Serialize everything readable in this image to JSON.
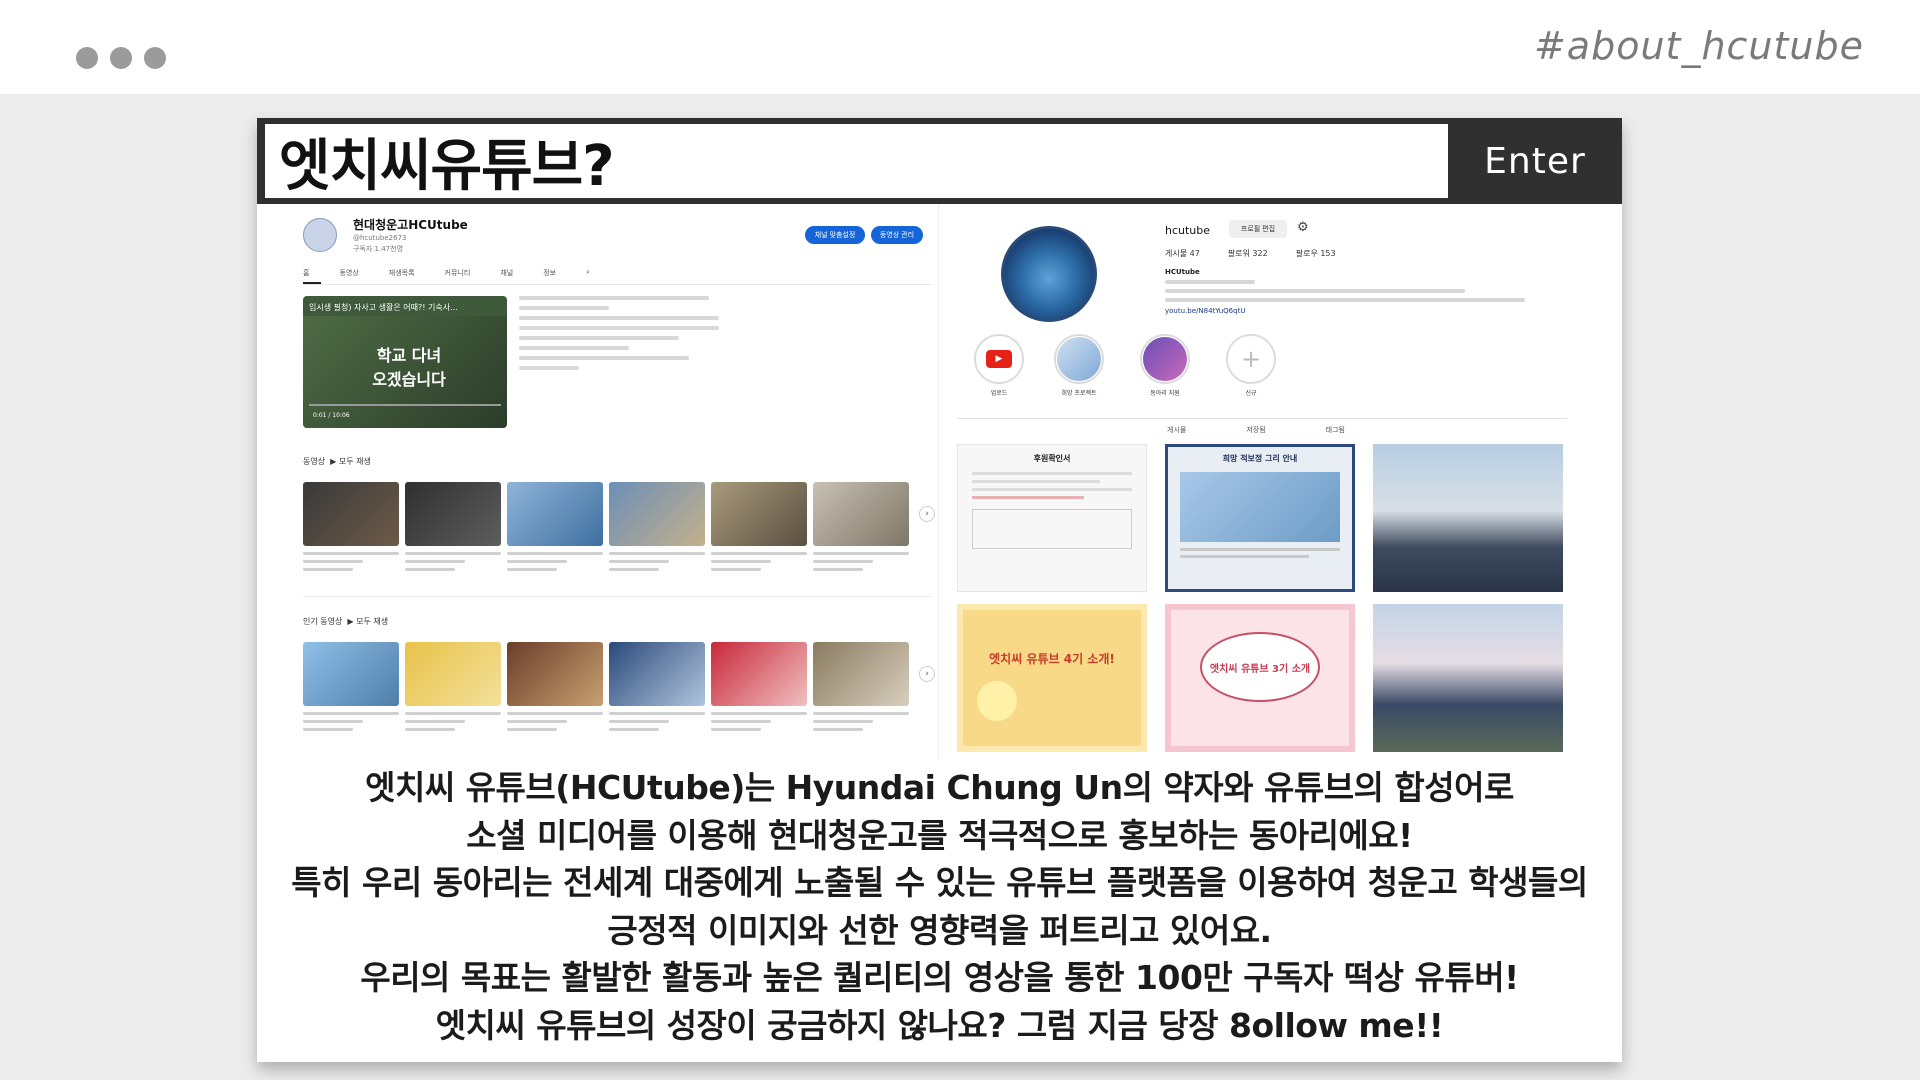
{
  "header": {
    "hashtag": "#about_hcutube"
  },
  "panel": {
    "title": "엣치씨유튜브?",
    "enter_label": "Enter"
  },
  "youtube": {
    "channel_name": "현대청운고HCUtube",
    "handle": "@hcutube2673",
    "subscribers": "구독자 1.47천명",
    "btn_customize": "채널 맞춤설정",
    "btn_manage": "동영상 관리",
    "tabs": [
      "홈",
      "동영상",
      "재생목록",
      "커뮤니티",
      "채널",
      "정보"
    ],
    "featured_title": "입시생 필청) 자사고 생활은 어때?! 기숙사...",
    "featured_caption": "학교 다녀 오겠습니다",
    "featured_time": "0:01 / 10:06",
    "section_videos": "동영상",
    "section_popular": "인기 동영상",
    "play_all": "모두 재생"
  },
  "instagram": {
    "username": "hcutube",
    "edit_label": "프로필 편집",
    "stats": [
      "게시물 47",
      "팔로워 322",
      "팔로우 153"
    ],
    "bio_name": "HCUtube",
    "bio_link": "youtu.be/N84tYuQ6qtU",
    "highlights": [
      "업로드",
      "희망 프로젝트",
      "동아리 지원",
      "신규"
    ],
    "tabs": [
      "게시물",
      "저장됨",
      "태그됨"
    ],
    "posts": [
      "후원확인서",
      "희망 적보정 그리 안내",
      "",
      "엣치씨 유튜브 4기 소개!",
      "엣치씨 유튜브 3기 소개",
      ""
    ]
  },
  "description": {
    "lines": [
      "엣치씨 유튜브(HCUtube)는 Hyundai Chung Un의 약자와 유튜브의 합성어로",
      "소셜 미디어를 이용해 현대청운고를 적극적으로 홍보하는 동아리에요!",
      "특히 우리 동아리는 전세계 대중에게 노출될 수 있는 유튜브 플랫폼을 이용하여 청운고 학생들의",
      "긍정적 이미지와 선한 영향력을 퍼트리고 있어요.",
      "우리의 목표는 활발한 활동과 높은 퀄리티의 영상을 통한 100만 구독자 떡상 유튜버!",
      "엣치씨 유튜브의 성장이 궁금하지 않나요? 그럼 지금 당장 8ollow me!!"
    ]
  },
  "colors": {
    "titlebar": "#303030",
    "youtube_button": "#1565d8",
    "dots": "#9b9b9b"
  }
}
